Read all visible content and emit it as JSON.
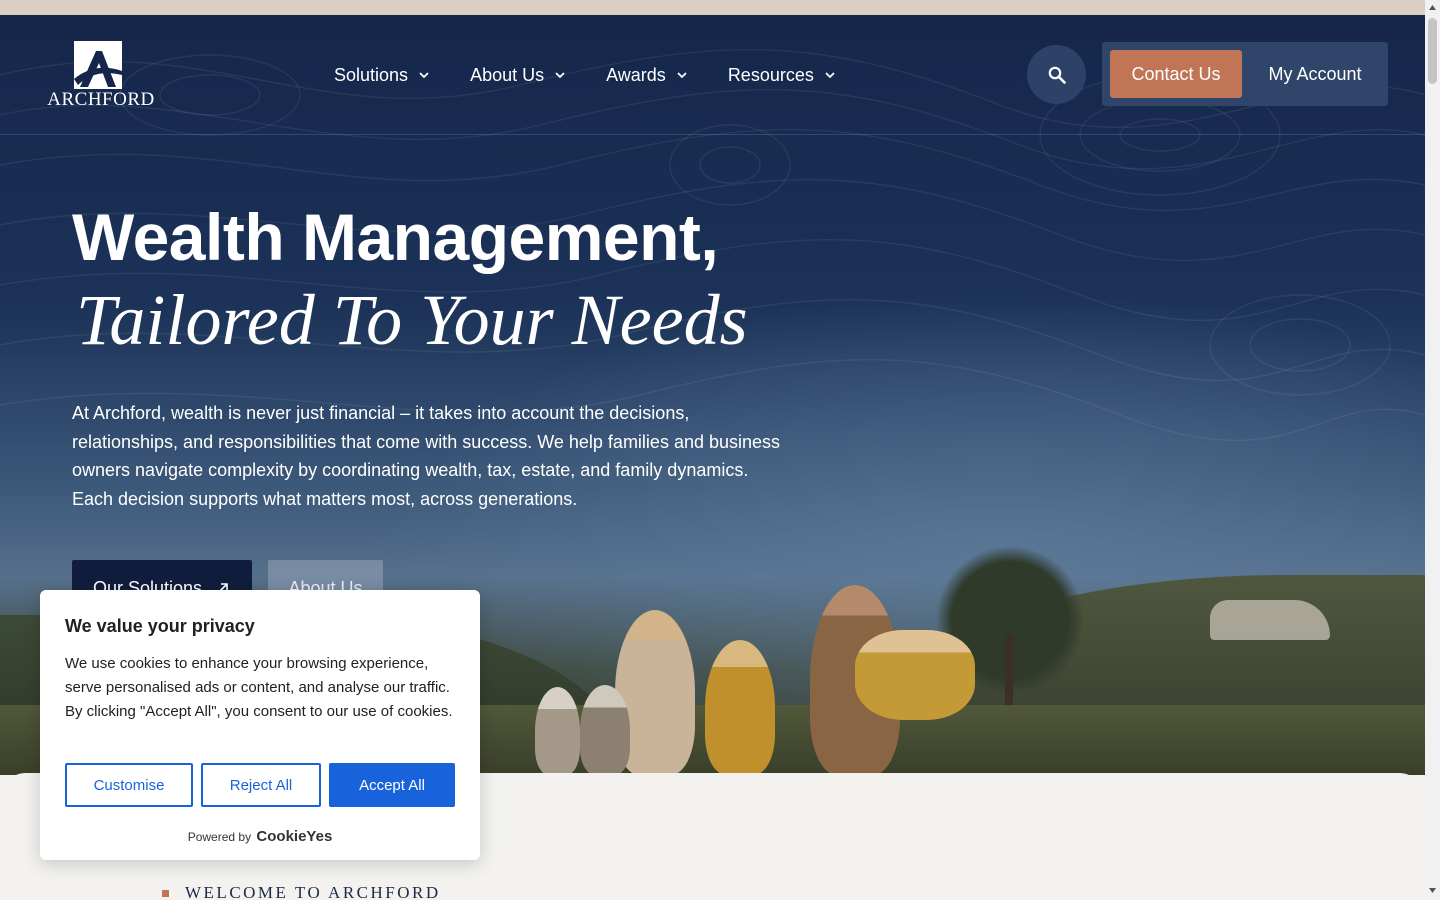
{
  "brand": {
    "name": "ARCHFORD"
  },
  "nav": {
    "items": [
      {
        "label": "Solutions"
      },
      {
        "label": "About Us"
      },
      {
        "label": "Awards"
      },
      {
        "label": "Resources"
      }
    ],
    "contact_label": "Contact Us",
    "account_label": "My Account"
  },
  "hero": {
    "headline": "Wealth Management,",
    "headline_italic": "Tailored To Your Needs",
    "body": "At Archford, wealth is never just financial – it takes into account the decisions, relationships, and responsibilities that come with success. We help families and business owners navigate complexity by coordinating wealth, tax, estate, and family dynamics. Each decision supports what matters most, across generations.",
    "primary_button": "Our Solutions",
    "secondary_button": "About Us"
  },
  "section": {
    "eyebrow": "WELCOME TO ARCHFORD"
  },
  "cookie_banner": {
    "title": "We value your privacy",
    "body": "We use cookies to enhance your browsing experience, serve personalised ads or content, and analyse our traffic. By clicking \"Accept All\", you consent to our use of cookies.",
    "customise": "Customise",
    "reject": "Reject All",
    "accept": "Accept All",
    "powered_by": "Powered by",
    "powered_brand": "CookieYes"
  },
  "colors": {
    "navy": "#15264a",
    "accent": "#c07656",
    "cookie_blue": "#1863dc"
  }
}
